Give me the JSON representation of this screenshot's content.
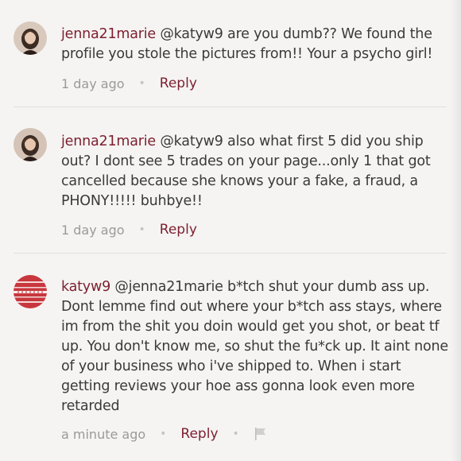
{
  "comments": [
    {
      "username": "jenna21marie",
      "text": " @katyw9 are you dumb?? We found the profile you stole the pictures from!! Your a psycho girl!",
      "time": "1 day ago",
      "reply_label": "Reply",
      "avatar": "woman-selfie-avatar"
    },
    {
      "username": "jenna21marie",
      "text": " @katyw9 also what first 5 did you ship out? I dont see 5 trades on your page...only 1 that got cancelled because she knows your a fake, a fraud, a PHONY!!!!! buhbye!!",
      "time": "1 day ago",
      "reply_label": "Reply",
      "avatar": "woman-selfie-avatar"
    },
    {
      "username": "katyw9",
      "text": " @jenna21marie b*tch shut your dumb ass up. Dont lemme find out where your b*tch ass stays, where im from the shit you doin would get you shot, or beat tf up. You don't know me, so shut the fu*ck up. It aint none of your business who i've shipped to. When i start getting reviews your hoe ass gonna look even more retarded",
      "time": "a minute ago",
      "reply_label": "Reply",
      "avatar": "red-pattern-avatar",
      "flag_icon": "flag-icon"
    }
  ],
  "colors": {
    "background": "#f5f4f3",
    "username": "#7d1f2e",
    "reply": "#7d1f2e",
    "text": "#3a3a3a",
    "meta": "#9a9a9a"
  }
}
